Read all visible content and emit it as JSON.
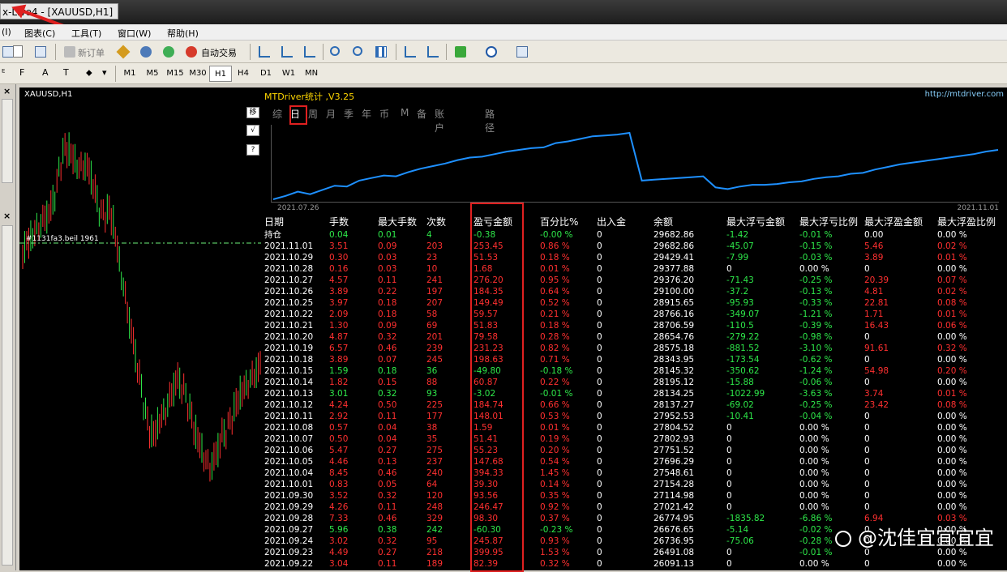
{
  "window": {
    "title": "x-Live4 - [XAUUSD,H1]"
  },
  "menu": [
    "(I)",
    "图表(C)",
    "工具(T)",
    "窗口(W)",
    "帮助(H)"
  ],
  "toolbar": {
    "new_order": "新订单",
    "auto_trade": "自动交易"
  },
  "timeframes": [
    "M1",
    "M5",
    "M15",
    "M30",
    "H1",
    "H4",
    "D1",
    "W1",
    "MN"
  ],
  "active_timeframe": "H1",
  "chart": {
    "symbol": "XAUUSD,H1",
    "level_label": "#1131fa3.beil 1961"
  },
  "panel": {
    "header": "MTDriver统计 ,V3.25",
    "url": "http://mtdriver.com",
    "tabs": [
      "综",
      "日",
      "周",
      "月",
      "季",
      "年",
      "币",
      "M",
      "备",
      "账户",
      "路径"
    ],
    "active_tab": "日",
    "side_buttons": [
      "移",
      "√",
      "?"
    ],
    "date_start": "2021.07.26",
    "date_end": "2021.11.01"
  },
  "equity_curve": [
    25800,
    26000,
    26250,
    26100,
    26350,
    26600,
    26550,
    26900,
    27050,
    27200,
    27150,
    27400,
    27600,
    27750,
    27900,
    28100,
    28250,
    28300,
    28450,
    28600,
    28700,
    28800,
    28850,
    29100,
    29200,
    29350,
    29500,
    29550,
    29600,
    29700,
    26900,
    26950,
    27000,
    27050,
    27100,
    27150,
    26500,
    26400,
    26550,
    26650,
    26650,
    26700,
    26800,
    26850,
    27000,
    27100,
    27150,
    27300,
    27350,
    27550,
    27700,
    27850,
    27950,
    28050,
    28150,
    28250,
    28350,
    28450,
    28600,
    28700
  ],
  "table": {
    "headers": [
      "日期",
      "手数",
      "最大手数",
      "次数",
      "盈亏金额",
      "百分比%",
      "出入金",
      "余额",
      "最大浮亏金额",
      "最大浮亏比例",
      "最大浮盈金额",
      "最大浮盈比例"
    ],
    "rows": [
      [
        "持仓",
        "0.04",
        "0.01",
        "4",
        "-0.38",
        "-0.00 %",
        "0",
        "29682.86",
        "-1.42",
        "-0.01 %",
        "0.00",
        "0.00 %"
      ],
      [
        "2021.11.01",
        "3.51",
        "0.09",
        "203",
        "253.45",
        "0.86 %",
        "0",
        "29682.86",
        "-45.07",
        "-0.15 %",
        "5.46",
        "0.02 %"
      ],
      [
        "2021.10.29",
        "0.30",
        "0.03",
        "23",
        "51.53",
        "0.18 %",
        "0",
        "29429.41",
        "-7.99",
        "-0.03 %",
        "3.89",
        "0.01 %"
      ],
      [
        "2021.10.28",
        "0.16",
        "0.03",
        "10",
        "1.68",
        "0.01 %",
        "0",
        "29377.88",
        "0",
        "0.00 %",
        "0",
        "0.00 %"
      ],
      [
        "2021.10.27",
        "4.57",
        "0.11",
        "241",
        "276.20",
        "0.95 %",
        "0",
        "29376.20",
        "-71.43",
        "-0.25 %",
        "20.39",
        "0.07 %"
      ],
      [
        "2021.10.26",
        "3.89",
        "0.22",
        "197",
        "184.35",
        "0.64 %",
        "0",
        "29100.00",
        "-37.2",
        "-0.13 %",
        "4.81",
        "0.02 %"
      ],
      [
        "2021.10.25",
        "3.97",
        "0.18",
        "207",
        "149.49",
        "0.52 %",
        "0",
        "28915.65",
        "-95.93",
        "-0.33 %",
        "22.81",
        "0.08 %"
      ],
      [
        "2021.10.22",
        "2.09",
        "0.18",
        "58",
        "59.57",
        "0.21 %",
        "0",
        "28766.16",
        "-349.07",
        "-1.21 %",
        "1.71",
        "0.01 %"
      ],
      [
        "2021.10.21",
        "1.30",
        "0.09",
        "69",
        "51.83",
        "0.18 %",
        "0",
        "28706.59",
        "-110.5",
        "-0.39 %",
        "16.43",
        "0.06 %"
      ],
      [
        "2021.10.20",
        "4.87",
        "0.32",
        "201",
        "79.58",
        "0.28 %",
        "0",
        "28654.76",
        "-279.22",
        "-0.98 %",
        "0",
        "0.00 %"
      ],
      [
        "2021.10.19",
        "6.57",
        "0.46",
        "239",
        "231.23",
        "0.82 %",
        "0",
        "28575.18",
        "-881.52",
        "-3.10 %",
        "91.61",
        "0.32 %"
      ],
      [
        "2021.10.18",
        "3.89",
        "0.07",
        "245",
        "198.63",
        "0.71 %",
        "0",
        "28343.95",
        "-173.54",
        "-0.62 %",
        "0",
        "0.00 %"
      ],
      [
        "2021.10.15",
        "1.59",
        "0.18",
        "36",
        "-49.80",
        "-0.18 %",
        "0",
        "28145.32",
        "-350.62",
        "-1.24 %",
        "54.98",
        "0.20 %"
      ],
      [
        "2021.10.14",
        "1.82",
        "0.15",
        "88",
        "60.87",
        "0.22 %",
        "0",
        "28195.12",
        "-15.88",
        "-0.06 %",
        "0",
        "0.00 %"
      ],
      [
        "2021.10.13",
        "3.01",
        "0.32",
        "93",
        "-3.02",
        "-0.01 %",
        "0",
        "28134.25",
        "-1022.99",
        "-3.63 %",
        "3.74",
        "0.01 %"
      ],
      [
        "2021.10.12",
        "4.24",
        "0.50",
        "225",
        "184.74",
        "0.66 %",
        "0",
        "28137.27",
        "-69.02",
        "-0.25 %",
        "23.42",
        "0.08 %"
      ],
      [
        "2021.10.11",
        "2.92",
        "0.11",
        "177",
        "148.01",
        "0.53 %",
        "0",
        "27952.53",
        "-10.41",
        "-0.04 %",
        "0",
        "0.00 %"
      ],
      [
        "2021.10.08",
        "0.57",
        "0.04",
        "38",
        "1.59",
        "0.01 %",
        "0",
        "27804.52",
        "0",
        "0.00 %",
        "0",
        "0.00 %"
      ],
      [
        "2021.10.07",
        "0.50",
        "0.04",
        "35",
        "51.41",
        "0.19 %",
        "0",
        "27802.93",
        "0",
        "0.00 %",
        "0",
        "0.00 %"
      ],
      [
        "2021.10.06",
        "5.47",
        "0.27",
        "275",
        "55.23",
        "0.20 %",
        "0",
        "27751.52",
        "0",
        "0.00 %",
        "0",
        "0.00 %"
      ],
      [
        "2021.10.05",
        "4.46",
        "0.13",
        "237",
        "147.68",
        "0.54 %",
        "0",
        "27696.29",
        "0",
        "0.00 %",
        "0",
        "0.00 %"
      ],
      [
        "2021.10.04",
        "8.45",
        "0.46",
        "240",
        "394.33",
        "1.45 %",
        "0",
        "27548.61",
        "0",
        "0.00 %",
        "0",
        "0.00 %"
      ],
      [
        "2021.10.01",
        "0.83",
        "0.05",
        "64",
        "39.30",
        "0.14 %",
        "0",
        "27154.28",
        "0",
        "0.00 %",
        "0",
        "0.00 %"
      ],
      [
        "2021.09.30",
        "3.52",
        "0.32",
        "120",
        "93.56",
        "0.35 %",
        "0",
        "27114.98",
        "0",
        "0.00 %",
        "0",
        "0.00 %"
      ],
      [
        "2021.09.29",
        "4.26",
        "0.11",
        "248",
        "246.47",
        "0.92 %",
        "0",
        "27021.42",
        "0",
        "0.00 %",
        "0",
        "0.00 %"
      ],
      [
        "2021.09.28",
        "7.33",
        "0.46",
        "329",
        "98.30",
        "0.37 %",
        "0",
        "26774.95",
        "-1835.82",
        "-6.86 %",
        "6.94",
        "0.03 %"
      ],
      [
        "2021.09.27",
        "5.96",
        "0.38",
        "242",
        "-60.30",
        "-0.23 %",
        "0",
        "26676.65",
        "-5.14",
        "-0.02 %",
        "0",
        "0.00 %"
      ],
      [
        "2021.09.24",
        "3.02",
        "0.32",
        "95",
        "245.87",
        "0.93 %",
        "0",
        "26736.95",
        "-75.06",
        "-0.28 %",
        "0",
        "0.00 %"
      ],
      [
        "2021.09.23",
        "4.49",
        "0.27",
        "218",
        "399.95",
        "1.53 %",
        "0",
        "26491.08",
        "0",
        "-0.01 %",
        "0",
        "0.00 %"
      ],
      [
        "2021.09.22",
        "3.04",
        "0.11",
        "189",
        "82.39",
        "0.32 %",
        "0",
        "26091.13",
        "0",
        "0.00 %",
        "0",
        "0.00 %"
      ]
    ]
  },
  "watermark": "@沈佳宜宜宜宜",
  "colors": {
    "profit": "#ff3030",
    "loss": "#2ee84a",
    "curve": "#1e90ff",
    "highlight": "#e02020"
  }
}
